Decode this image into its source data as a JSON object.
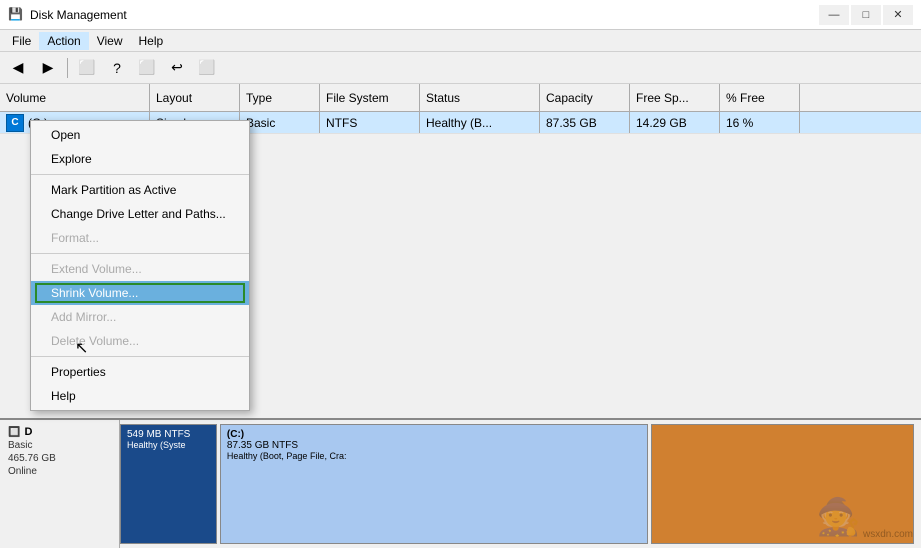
{
  "window": {
    "title": "Disk Management",
    "icon": "💾"
  },
  "titlebar": {
    "minimize": "—",
    "maximize": "□",
    "close": "✕"
  },
  "menubar": {
    "items": [
      "File",
      "Action",
      "View",
      "Help"
    ]
  },
  "toolbar": {
    "buttons": [
      "◀",
      "▶",
      "⬛",
      "?",
      "⬛",
      "↩",
      "⬛"
    ]
  },
  "table": {
    "headers": [
      "Volume",
      "Layout",
      "Type",
      "File System",
      "Status",
      "Capacity",
      "Free Sp...",
      "% Free"
    ],
    "rows": [
      {
        "volume": "(C:)",
        "layout": "Simple",
        "type": "Basic",
        "filesystem": "NTFS",
        "status": "Healthy (B...",
        "capacity": "87.35 GB",
        "freesp": "14.29 GB",
        "pctfree": "16 %"
      }
    ]
  },
  "contextmenu": {
    "items": [
      {
        "label": "Open",
        "disabled": false,
        "highlighted": false
      },
      {
        "label": "Explore",
        "disabled": false,
        "highlighted": false
      },
      {
        "label": "",
        "type": "separator"
      },
      {
        "label": "Mark Partition as Active",
        "disabled": false,
        "highlighted": false
      },
      {
        "label": "Change Drive Letter and Paths...",
        "disabled": false,
        "highlighted": false
      },
      {
        "label": "Format...",
        "disabled": true,
        "highlighted": false
      },
      {
        "label": "",
        "type": "separator"
      },
      {
        "label": "Extend Volume...",
        "disabled": true,
        "highlighted": false
      },
      {
        "label": "Shrink Volume...",
        "disabled": false,
        "highlighted": true
      },
      {
        "label": "Add Mirror...",
        "disabled": true,
        "highlighted": false
      },
      {
        "label": "Delete Volume...",
        "disabled": true,
        "highlighted": false
      },
      {
        "label": "",
        "type": "separator"
      },
      {
        "label": "Properties",
        "disabled": false,
        "highlighted": false
      },
      {
        "label": "Help",
        "disabled": false,
        "highlighted": false
      }
    ]
  },
  "diskpanel": {
    "disk": {
      "label": "D",
      "type": "Basic",
      "size": "465.76 GB",
      "status": "Online"
    },
    "partitions": [
      {
        "name": "",
        "size": "549 MB NTFS",
        "status": "Healthy (Syste",
        "color": "dark",
        "flex": 1
      },
      {
        "name": "(C:)",
        "size": "87.35 GB NTFS",
        "status": "Healthy (Boot, Page File, Cra:",
        "color": "light",
        "flex": 4
      },
      {
        "name": "",
        "size": "",
        "status": "",
        "color": "orange",
        "flex": 2
      }
    ]
  },
  "watermark": "wsxdn.com"
}
